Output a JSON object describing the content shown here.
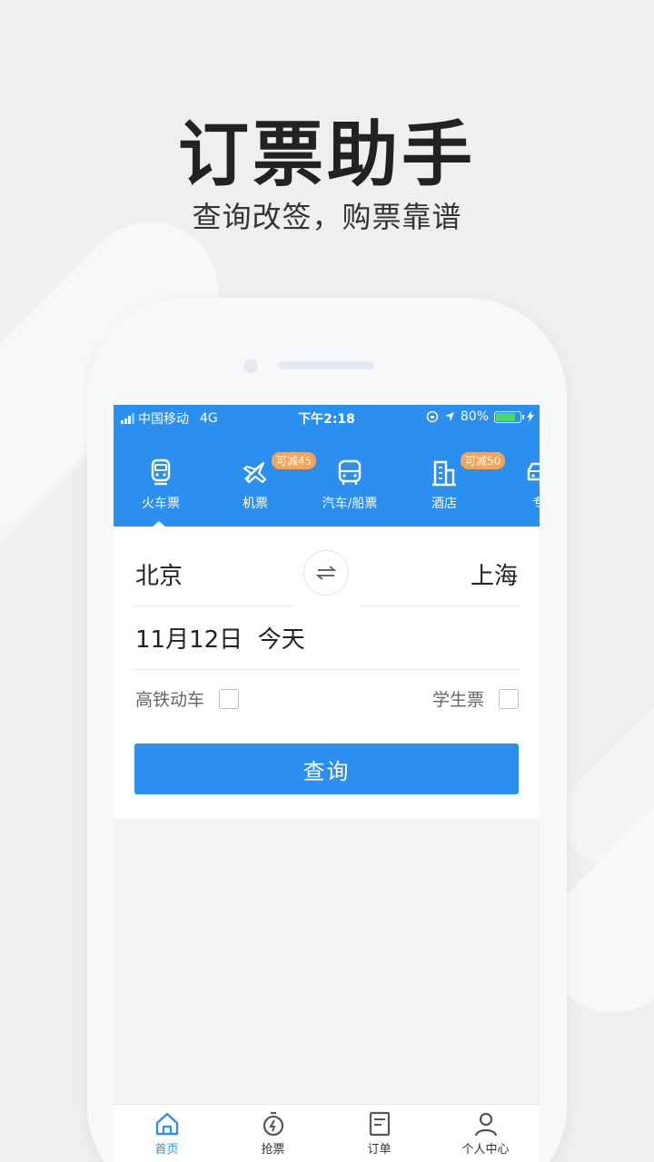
{
  "promo": {
    "title": "订票助手",
    "subtitle": "查询改签，购票靠谱"
  },
  "status_bar": {
    "carrier": "中国移动",
    "network": "4G",
    "time": "下午2:18",
    "battery_percent": "80%",
    "battery_level": 0.8
  },
  "tabs": [
    {
      "label": "火车票",
      "icon": "train-icon",
      "active": true
    },
    {
      "label": "机票",
      "icon": "plane-icon",
      "badge": "可减45"
    },
    {
      "label": "汽车/船票",
      "icon": "bus-icon"
    },
    {
      "label": "酒店",
      "icon": "hotel-icon",
      "badge": "可减50"
    },
    {
      "label": "专",
      "icon": "car-icon"
    }
  ],
  "search": {
    "from_city": "北京",
    "to_city": "上海",
    "date": "11月12日  今天",
    "option_high_speed": "高铁动车",
    "option_student": "学生票",
    "button_label": "查询"
  },
  "bottom_nav": [
    {
      "label": "首页",
      "icon": "home-icon",
      "active": true
    },
    {
      "label": "抢票",
      "icon": "stopwatch-icon"
    },
    {
      "label": "订单",
      "icon": "document-icon"
    },
    {
      "label": "个人中心",
      "icon": "user-icon"
    }
  ],
  "colors": {
    "brand_blue": "#2b8ff0",
    "badge_orange": "#f5a45c",
    "battery_green": "#4cd964"
  }
}
